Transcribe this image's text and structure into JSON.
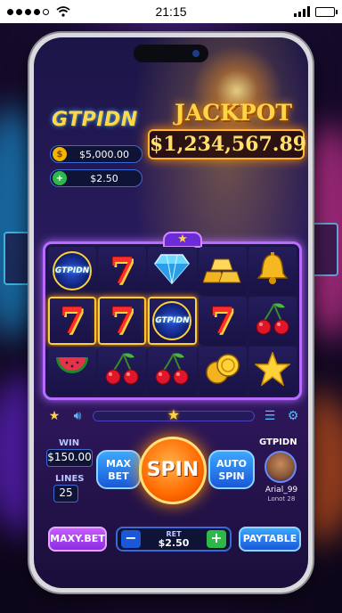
{
  "status_bar": {
    "time": "21:15"
  },
  "header": {
    "logo": "GTPIDN",
    "jackpot_title": "JACKPOT",
    "jackpot_amount": "$1,234,567.89",
    "balance": "$5,000.00",
    "bet_amount": "$2.50"
  },
  "reels": [
    [
      {
        "symbol": "GTPIDN",
        "icon": "badge-icon",
        "win": false
      },
      {
        "symbol": "7",
        "icon": "seven-icon",
        "win": false
      },
      {
        "symbol": "diamond",
        "icon": "diamond-icon",
        "win": false
      },
      {
        "symbol": "gold-bars",
        "icon": "gold-bars-icon",
        "win": false
      },
      {
        "symbol": "bell",
        "icon": "bell-icon",
        "win": false
      }
    ],
    [
      {
        "symbol": "7",
        "icon": "seven-icon",
        "win": true
      },
      {
        "symbol": "7",
        "icon": "seven-icon",
        "win": true
      },
      {
        "symbol": "GTPIDN",
        "icon": "badge-icon",
        "win": true
      },
      {
        "symbol": "7",
        "icon": "seven-icon",
        "win": false
      },
      {
        "symbol": "cherries",
        "icon": "cherries-icon",
        "win": false
      }
    ],
    [
      {
        "symbol": "watermelon",
        "icon": "watermelon-icon",
        "win": false
      },
      {
        "symbol": "cherries",
        "icon": "cherries-icon",
        "win": false
      },
      {
        "symbol": "cherries",
        "icon": "cherries-icon",
        "win": false
      },
      {
        "symbol": "coins",
        "icon": "coins-icon",
        "win": false
      },
      {
        "symbol": "star",
        "icon": "star-icon",
        "win": false
      }
    ]
  ],
  "controls": {
    "win_label": "WIN",
    "win_value": "$150.00",
    "lines_label": "LINES",
    "lines_value": "25",
    "max_bet_label": "MAX BET",
    "spin_label": "SPIN",
    "auto_spin_label": "AUTO SPIN",
    "player_brand": "GTPIDN",
    "player_name": "Arial_99",
    "player_level": "Lonot 28",
    "maxy_bet_label": "MAXY.BET",
    "bet_label": "RET",
    "bet_value": "$2.50",
    "minus_label": "−",
    "plus_label": "+",
    "paytable_label": "PAYTABLE"
  },
  "colors": {
    "accent_gold": "#ffd447",
    "reel_frame": "#b86bff",
    "spin": "#ff6a00"
  }
}
